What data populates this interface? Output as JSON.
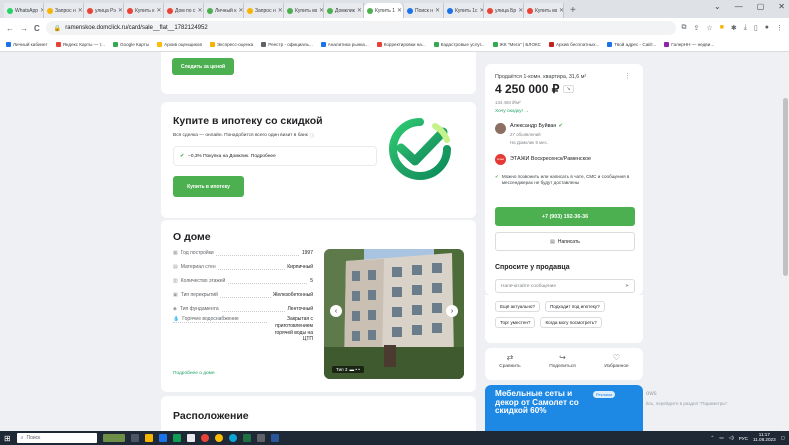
{
  "tabs": [
    {
      "label": "WhatsApp",
      "color": "#25d366",
      "active": false
    },
    {
      "label": "Запрос н",
      "color": "#f4b400",
      "active": false
    },
    {
      "label": "улица Рэ",
      "color": "#ea4335",
      "active": false
    },
    {
      "label": "Купить к",
      "color": "#ea4335",
      "active": false
    },
    {
      "label": "Дом по с",
      "color": "#ea4335",
      "active": false
    },
    {
      "label": "Личный к",
      "color": "#4caf50",
      "active": false
    },
    {
      "label": "Запрос н",
      "color": "#f4b400",
      "active": false
    },
    {
      "label": "Купить кв",
      "color": "#4caf50",
      "active": false
    },
    {
      "label": "Домклик",
      "color": "#4caf50",
      "active": false
    },
    {
      "label": "Купить 1",
      "color": "#4caf50",
      "active": true
    },
    {
      "label": "Поиск н",
      "color": "#1a73e8",
      "active": false
    },
    {
      "label": "Купить 1с",
      "color": "#1a73e8",
      "active": false
    },
    {
      "label": "улица Бр",
      "color": "#ea4335",
      "active": false
    },
    {
      "label": "Купить кв",
      "color": "#ea4335",
      "active": false
    }
  ],
  "window": {
    "minimize": "⌄",
    "min": "—",
    "max": "▢",
    "close": "✕",
    "new_tab": "+"
  },
  "toolbar": {
    "url": "ramenskoe.domclick.ru/card/sale__flat__1782124952",
    "back": "←",
    "forward": "→",
    "reload": "C"
  },
  "bookmarks": [
    {
      "label": "Личный кабинет",
      "color": "#1a73e8"
    },
    {
      "label": "Яндекс Карты — т...",
      "color": "#ea4335"
    },
    {
      "label": "Google Карты",
      "color": "#34a853"
    },
    {
      "label": "Архив оценщиков",
      "color": "#fbbc04"
    },
    {
      "label": "Экспресс-оценка",
      "color": "#f4b400"
    },
    {
      "label": "Реестр - официаль...",
      "color": "#5f6368"
    },
    {
      "label": "Аналитика рынка...",
      "color": "#1a73e8"
    },
    {
      "label": "Корректировки на...",
      "color": "#ea4335"
    },
    {
      "label": "Кадастровые услуг...",
      "color": "#34a853"
    },
    {
      "label": "ЖК \"Мега\" | БЛОКС",
      "color": "#34a853"
    },
    {
      "label": "Архив бесплатных...",
      "color": "#c5221f"
    },
    {
      "label": "Твой адрес - Сайт...",
      "color": "#1a73e8"
    },
    {
      "label": "ГалерНН — недви...",
      "color": "#8e24aa"
    }
  ],
  "main": {
    "follow_price_button": "Следить за ценой",
    "mortgage": {
      "title": "Купите в ипотеку со скидкой",
      "subtitle": "Вся сделка — онлайн. Понадобится всего один визит в банк",
      "discount_text": "−0,3% Покупка на Домклик. Подробнее",
      "button": "Купить в ипотеку"
    },
    "house": {
      "title": "О доме",
      "rows": [
        {
          "label": "Год постройки",
          "value": "1997",
          "icon": "calendar-icon"
        },
        {
          "label": "Материал стен",
          "value": "Кирпичный",
          "icon": "wall-icon"
        },
        {
          "label": "Количество этажей",
          "value": "5",
          "icon": "floors-icon"
        },
        {
          "label": "Тип перекрытий",
          "value": "Железобетонный",
          "icon": "slab-icon"
        },
        {
          "label": "Тип фундамента",
          "value": "Ленточный",
          "icon": "foundation-icon"
        },
        {
          "label": "Горячее водоснабжение",
          "value": "Закрытая с приготовлением горячей воды на ЦТП",
          "icon": "water-icon"
        }
      ],
      "more_link": "Подробнее о доме",
      "photo_caption": "Тип 3"
    },
    "location_title": "Расположение"
  },
  "sidebar": {
    "sale_title": "Продаётся 1-комн. квартира, 31,6 м²",
    "price": "4 250 000 ₽",
    "price_per_m": "134 493 ₽/м²",
    "discount_link": "Хочу скидку! →",
    "agent_name": "Александр Буйван",
    "agent_ads": "27 объявлений",
    "agent_since": "На Домклик 5 мес.",
    "agency": "ЭТАЖИ Воскресенск/Раменское",
    "agency_logo": "этажи",
    "contact_note": "Можно позвонить или написать в чате, СМС и сообщения в мессенджерах не будут доставлены",
    "phone_button": "+7 (903) 192-36-36",
    "write_button": "Написать",
    "ask_title": "Спросите у продавца",
    "message_placeholder": "Напечатайте сообщение",
    "quick_questions": [
      "Ещё актуально?",
      "Подходит под ипотеку?",
      "Торг уместен?",
      "Когда могу посмотреть?"
    ],
    "actions": [
      {
        "label": "Сравнить",
        "icon": "compare-icon",
        "glyph": "⇄"
      },
      {
        "label": "Поделиться",
        "icon": "share-icon",
        "glyph": "↪"
      },
      {
        "label": "Избранное",
        "icon": "heart-icon",
        "glyph": "♡"
      }
    ],
    "ad_text": "Мебельные сеты и декор от Самолет со скидкой 60%",
    "ad_badge": "Реклама",
    "activate_windows": "ows",
    "activate_windows_sub": "йсь, перейдите в раздел \"Параметры\"."
  },
  "taskbar": {
    "search": "Поиск",
    "lang": "РУС",
    "time": "11:17",
    "date": "11.08.2023"
  },
  "colors": {
    "accent": "#4caf50",
    "ad_bg": "#1e88e5"
  }
}
